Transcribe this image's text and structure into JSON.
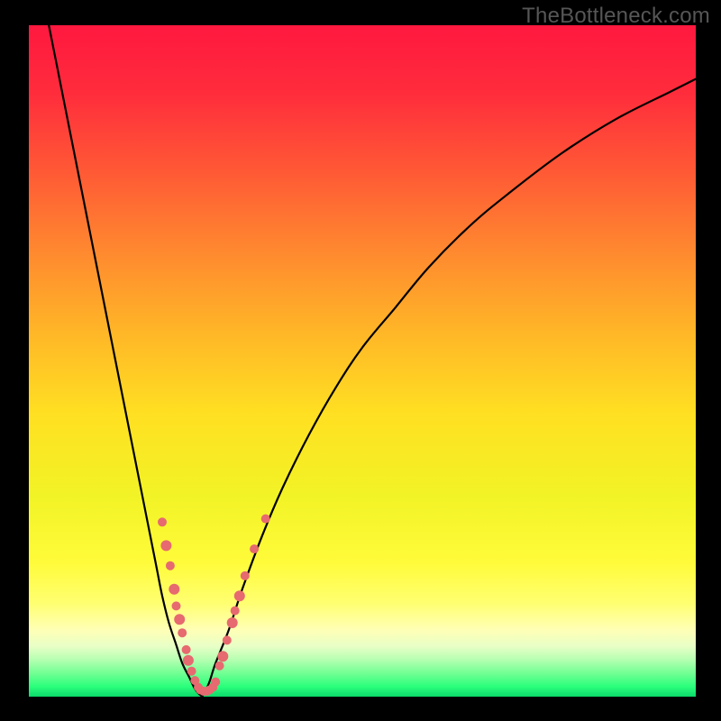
{
  "watermark": "TheBottleneck.com",
  "gradient": {
    "stops": [
      {
        "offset": 0.0,
        "color": "#ff183f"
      },
      {
        "offset": 0.1,
        "color": "#ff2c3c"
      },
      {
        "offset": 0.22,
        "color": "#ff5a35"
      },
      {
        "offset": 0.34,
        "color": "#ff8a2f"
      },
      {
        "offset": 0.46,
        "color": "#ffb727"
      },
      {
        "offset": 0.58,
        "color": "#ffe022"
      },
      {
        "offset": 0.7,
        "color": "#f2f326"
      },
      {
        "offset": 0.8,
        "color": "#fffb3a"
      },
      {
        "offset": 0.86,
        "color": "#ffff70"
      },
      {
        "offset": 0.9,
        "color": "#ffffb5"
      },
      {
        "offset": 0.925,
        "color": "#e8ffc6"
      },
      {
        "offset": 0.945,
        "color": "#b5ffb1"
      },
      {
        "offset": 0.965,
        "color": "#72ff93"
      },
      {
        "offset": 0.985,
        "color": "#2bff7c"
      },
      {
        "offset": 1.0,
        "color": "#0bd96a"
      }
    ]
  },
  "chart_data": {
    "type": "line",
    "title": "",
    "xlabel": "",
    "ylabel": "",
    "xlim": [
      0,
      100
    ],
    "ylim": [
      0,
      100
    ],
    "notch": {
      "x": 26,
      "y": 0
    },
    "series": [
      {
        "name": "left-branch",
        "x": [
          3,
          5,
          7,
          9,
          11,
          13,
          15,
          17,
          19,
          20,
          21,
          22,
          23,
          24,
          25,
          26
        ],
        "y": [
          100,
          90,
          80,
          70,
          60,
          50,
          40,
          30,
          20,
          15,
          11,
          8,
          5,
          3,
          1,
          0
        ]
      },
      {
        "name": "right-branch",
        "x": [
          26,
          27,
          28,
          30,
          32,
          35,
          38,
          42,
          46,
          50,
          55,
          60,
          66,
          72,
          80,
          88,
          96,
          100
        ],
        "y": [
          0,
          2,
          5,
          10,
          16,
          24,
          31,
          39,
          46,
          52,
          58,
          64,
          70,
          75,
          81,
          86,
          90,
          92
        ]
      }
    ],
    "scatter": {
      "name": "data-points",
      "color": "#e66a6f",
      "points": [
        {
          "x": 20.0,
          "y": 26.0,
          "r": 5
        },
        {
          "x": 20.6,
          "y": 22.5,
          "r": 6
        },
        {
          "x": 21.2,
          "y": 19.5,
          "r": 5
        },
        {
          "x": 21.8,
          "y": 16.0,
          "r": 6
        },
        {
          "x": 22.1,
          "y": 13.5,
          "r": 5
        },
        {
          "x": 22.6,
          "y": 11.5,
          "r": 6
        },
        {
          "x": 23.0,
          "y": 9.5,
          "r": 5
        },
        {
          "x": 23.6,
          "y": 7.0,
          "r": 5
        },
        {
          "x": 23.9,
          "y": 5.4,
          "r": 6
        },
        {
          "x": 24.4,
          "y": 3.8,
          "r": 5
        },
        {
          "x": 24.9,
          "y": 2.4,
          "r": 5
        },
        {
          "x": 25.4,
          "y": 1.4,
          "r": 5
        },
        {
          "x": 25.7,
          "y": 1.0,
          "r": 5
        },
        {
          "x": 26.2,
          "y": 0.8,
          "r": 5
        },
        {
          "x": 26.7,
          "y": 0.8,
          "r": 5
        },
        {
          "x": 27.1,
          "y": 1.0,
          "r": 5
        },
        {
          "x": 27.6,
          "y": 1.4,
          "r": 5
        },
        {
          "x": 28.0,
          "y": 2.2,
          "r": 5
        },
        {
          "x": 28.6,
          "y": 4.6,
          "r": 5
        },
        {
          "x": 29.1,
          "y": 6.0,
          "r": 6
        },
        {
          "x": 29.7,
          "y": 8.4,
          "r": 5
        },
        {
          "x": 30.5,
          "y": 11.0,
          "r": 6
        },
        {
          "x": 30.9,
          "y": 12.8,
          "r": 5
        },
        {
          "x": 31.6,
          "y": 15.0,
          "r": 6
        },
        {
          "x": 32.4,
          "y": 18.0,
          "r": 5
        },
        {
          "x": 33.8,
          "y": 22.0,
          "r": 5
        },
        {
          "x": 35.5,
          "y": 26.5,
          "r": 5
        }
      ]
    }
  }
}
